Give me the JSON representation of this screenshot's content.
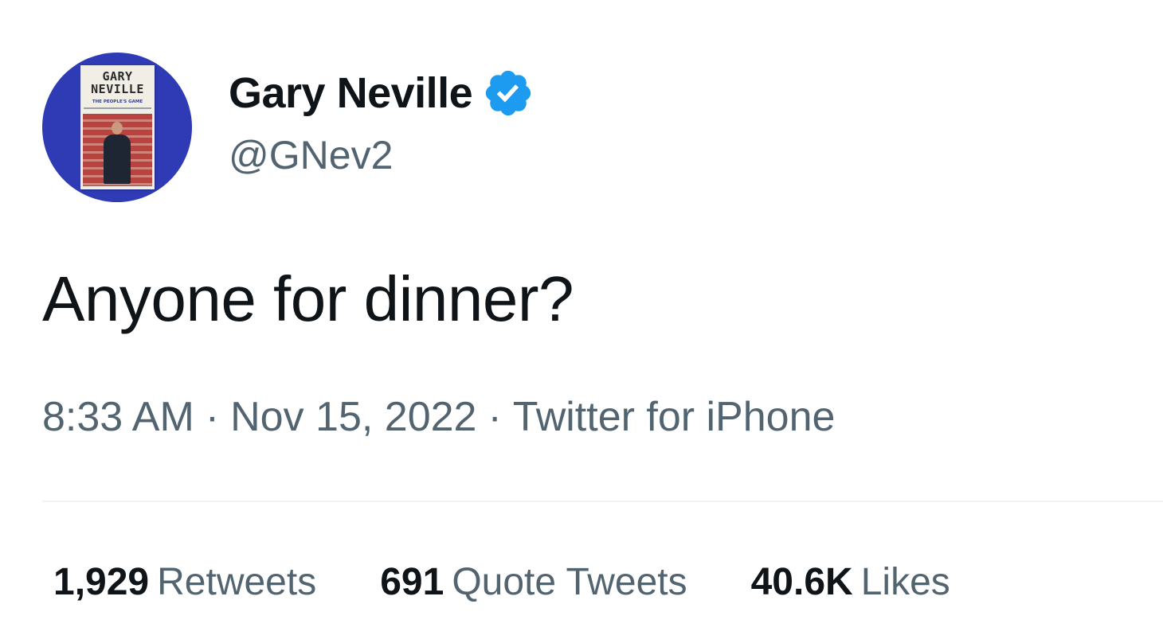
{
  "user": {
    "display_name": "Gary Neville",
    "handle": "@GNev2",
    "verified": true,
    "verified_color": "#1d9bf0",
    "avatar": {
      "book_title_line1": "GARY",
      "book_title_line2": "NEVILLE",
      "book_subtitle": "THE PEOPLE'S GAME",
      "background_color": "#2e3bb5"
    }
  },
  "tweet": {
    "text": "Anyone for dinner?",
    "time": "8:33 AM",
    "separator": "·",
    "date": "Nov 15, 2022",
    "source": "Twitter for iPhone"
  },
  "stats": {
    "retweets": {
      "count": "1,929",
      "label": "Retweets"
    },
    "quote_tweets": {
      "count": "691",
      "label": "Quote Tweets"
    },
    "likes": {
      "count": "40.6K",
      "label": "Likes"
    }
  },
  "colors": {
    "text_primary": "#0f1419",
    "text_secondary": "#536471",
    "divider": "#eff3f4"
  }
}
